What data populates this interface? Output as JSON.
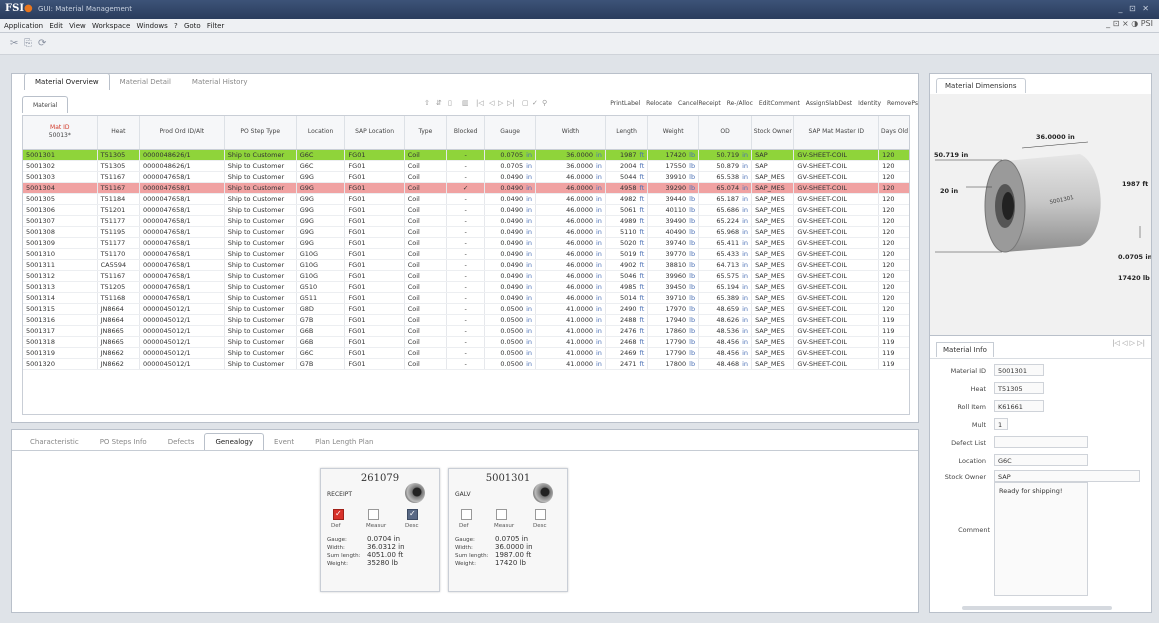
{
  "app": {
    "logo_text": "FSI",
    "window_title": "GUI: Material Management",
    "window_controls": "_ ⊡ ✕",
    "right_controls": "_ ⊡ × ◑ PSI"
  },
  "menu": [
    "Application",
    "Edit",
    "View",
    "Workspace",
    "Windows",
    "?",
    "Goto",
    "Filter"
  ],
  "main_tabs": [
    "Material Overview",
    "Material Detail",
    "Material History"
  ],
  "grid": {
    "label": "Material",
    "actions": [
      "PrintLabel",
      "Relocate",
      "CancelReceipt",
      "Re-/Alloc",
      "EditComment",
      "AssignSlabDest",
      "Identity",
      "RemovePs"
    ],
    "columns": [
      "Mat ID",
      "Heat",
      "Prod Ord ID/Alt",
      "PO Step Type",
      "Location",
      "SAP Location",
      "Type",
      "Blocked",
      "Gauge",
      "Width",
      "Length",
      "Weight",
      "OD",
      "Stock Owner",
      "SAP Mat Master ID",
      "Days Old"
    ],
    "filter_value": "50013*",
    "rows": [
      {
        "id": "5001301",
        "heat": "T51305",
        "po": "0000048626/1",
        "step": "Ship to Customer",
        "loc": "G6C",
        "sap": "FG01",
        "type": "Coil",
        "blocked": "-",
        "gauge": "0.0705",
        "width": "36.0000",
        "length": "1987",
        "weight": "17420",
        "od": "50.719",
        "owner": "SAP",
        "mm": "GV-SHEET-COIL",
        "days": "120",
        "hl": "green"
      },
      {
        "id": "5001302",
        "heat": "T51305",
        "po": "0000048626/1",
        "step": "Ship to Customer",
        "loc": "G6C",
        "sap": "FG01",
        "type": "Coil",
        "blocked": "-",
        "gauge": "0.0705",
        "width": "36.0000",
        "length": "2004",
        "weight": "17550",
        "od": "50.879",
        "owner": "SAP",
        "mm": "GV-SHEET-COIL",
        "days": "120",
        "hl": ""
      },
      {
        "id": "5001303",
        "heat": "T51167",
        "po": "0000047658/1",
        "step": "Ship to Customer",
        "loc": "G9G",
        "sap": "FG01",
        "type": "Coil",
        "blocked": "-",
        "gauge": "0.0490",
        "width": "46.0000",
        "length": "5044",
        "weight": "39910",
        "od": "65.538",
        "owner": "SAP_MES",
        "mm": "GV-SHEET-COIL",
        "days": "120",
        "hl": ""
      },
      {
        "id": "5001304",
        "heat": "T51167",
        "po": "0000047658/1",
        "step": "Ship to Customer",
        "loc": "G9G",
        "sap": "FG01",
        "type": "Coil",
        "blocked": "✓",
        "gauge": "0.0490",
        "width": "46.0000",
        "length": "4958",
        "weight": "39290",
        "od": "65.074",
        "owner": "SAP_MES",
        "mm": "GV-SHEET-COIL",
        "days": "120",
        "hl": "red"
      },
      {
        "id": "5001305",
        "heat": "T51184",
        "po": "0000047658/1",
        "step": "Ship to Customer",
        "loc": "G9G",
        "sap": "FG01",
        "type": "Coil",
        "blocked": "-",
        "gauge": "0.0490",
        "width": "46.0000",
        "length": "4982",
        "weight": "39440",
        "od": "65.187",
        "owner": "SAP_MES",
        "mm": "GV-SHEET-COIL",
        "days": "120",
        "hl": ""
      },
      {
        "id": "5001306",
        "heat": "T51201",
        "po": "0000047658/1",
        "step": "Ship to Customer",
        "loc": "G9G",
        "sap": "FG01",
        "type": "Coil",
        "blocked": "-",
        "gauge": "0.0490",
        "width": "46.0000",
        "length": "5061",
        "weight": "40110",
        "od": "65.686",
        "owner": "SAP_MES",
        "mm": "GV-SHEET-COIL",
        "days": "120",
        "hl": ""
      },
      {
        "id": "5001307",
        "heat": "T51177",
        "po": "0000047658/1",
        "step": "Ship to Customer",
        "loc": "G9G",
        "sap": "FG01",
        "type": "Coil",
        "blocked": "-",
        "gauge": "0.0490",
        "width": "46.0000",
        "length": "4989",
        "weight": "39490",
        "od": "65.224",
        "owner": "SAP_MES",
        "mm": "GV-SHEET-COIL",
        "days": "120",
        "hl": ""
      },
      {
        "id": "5001308",
        "heat": "T51195",
        "po": "0000047658/1",
        "step": "Ship to Customer",
        "loc": "G9G",
        "sap": "FG01",
        "type": "Coil",
        "blocked": "-",
        "gauge": "0.0490",
        "width": "46.0000",
        "length": "5110",
        "weight": "40490",
        "od": "65.968",
        "owner": "SAP_MES",
        "mm": "GV-SHEET-COIL",
        "days": "120",
        "hl": ""
      },
      {
        "id": "5001309",
        "heat": "T51177",
        "po": "0000047658/1",
        "step": "Ship to Customer",
        "loc": "G9G",
        "sap": "FG01",
        "type": "Coil",
        "blocked": "-",
        "gauge": "0.0490",
        "width": "46.0000",
        "length": "5020",
        "weight": "39740",
        "od": "65.411",
        "owner": "SAP_MES",
        "mm": "GV-SHEET-COIL",
        "days": "120",
        "hl": ""
      },
      {
        "id": "5001310",
        "heat": "T51170",
        "po": "0000047658/1",
        "step": "Ship to Customer",
        "loc": "G10G",
        "sap": "FG01",
        "type": "Coil",
        "blocked": "-",
        "gauge": "0.0490",
        "width": "46.0000",
        "length": "5019",
        "weight": "39770",
        "od": "65.433",
        "owner": "SAP_MES",
        "mm": "GV-SHEET-COIL",
        "days": "120",
        "hl": ""
      },
      {
        "id": "5001311",
        "heat": "CA5594",
        "po": "0000047658/1",
        "step": "Ship to Customer",
        "loc": "G10G",
        "sap": "FG01",
        "type": "Coil",
        "blocked": "-",
        "gauge": "0.0490",
        "width": "46.0000",
        "length": "4902",
        "weight": "38810",
        "od": "64.713",
        "owner": "SAP_MES",
        "mm": "GV-SHEET-COIL",
        "days": "120",
        "hl": ""
      },
      {
        "id": "5001312",
        "heat": "T51167",
        "po": "0000047658/1",
        "step": "Ship to Customer",
        "loc": "G10G",
        "sap": "FG01",
        "type": "Coil",
        "blocked": "-",
        "gauge": "0.0490",
        "width": "46.0000",
        "length": "5046",
        "weight": "39960",
        "od": "65.575",
        "owner": "SAP_MES",
        "mm": "GV-SHEET-COIL",
        "days": "120",
        "hl": ""
      },
      {
        "id": "5001313",
        "heat": "T51205",
        "po": "0000047658/1",
        "step": "Ship to Customer",
        "loc": "G510",
        "sap": "FG01",
        "type": "Coil",
        "blocked": "-",
        "gauge": "0.0490",
        "width": "46.0000",
        "length": "4985",
        "weight": "39450",
        "od": "65.194",
        "owner": "SAP_MES",
        "mm": "GV-SHEET-COIL",
        "days": "120",
        "hl": ""
      },
      {
        "id": "5001314",
        "heat": "T51168",
        "po": "0000047658/1",
        "step": "Ship to Customer",
        "loc": "G511",
        "sap": "FG01",
        "type": "Coil",
        "blocked": "-",
        "gauge": "0.0490",
        "width": "46.0000",
        "length": "5014",
        "weight": "39710",
        "od": "65.389",
        "owner": "SAP_MES",
        "mm": "GV-SHEET-COIL",
        "days": "120",
        "hl": ""
      },
      {
        "id": "5001315",
        "heat": "JN8664",
        "po": "0000045012/1",
        "step": "Ship to Customer",
        "loc": "G8D",
        "sap": "FG01",
        "type": "Coil",
        "blocked": "-",
        "gauge": "0.0500",
        "width": "41.0000",
        "length": "2490",
        "weight": "17970",
        "od": "48.659",
        "owner": "SAP_MES",
        "mm": "GV-SHEET-COIL",
        "days": "120",
        "hl": ""
      },
      {
        "id": "5001316",
        "heat": "JN8664",
        "po": "0000045012/1",
        "step": "Ship to Customer",
        "loc": "G7B",
        "sap": "FG01",
        "type": "Coil",
        "blocked": "-",
        "gauge": "0.0500",
        "width": "41.0000",
        "length": "2488",
        "weight": "17940",
        "od": "48.626",
        "owner": "SAP_MES",
        "mm": "GV-SHEET-COIL",
        "days": "119",
        "hl": ""
      },
      {
        "id": "5001317",
        "heat": "JN8665",
        "po": "0000045012/1",
        "step": "Ship to Customer",
        "loc": "G6B",
        "sap": "FG01",
        "type": "Coil",
        "blocked": "-",
        "gauge": "0.0500",
        "width": "41.0000",
        "length": "2476",
        "weight": "17860",
        "od": "48.536",
        "owner": "SAP_MES",
        "mm": "GV-SHEET-COIL",
        "days": "119",
        "hl": ""
      },
      {
        "id": "5001318",
        "heat": "JN8665",
        "po": "0000045012/1",
        "step": "Ship to Customer",
        "loc": "G6B",
        "sap": "FG01",
        "type": "Coil",
        "blocked": "-",
        "gauge": "0.0500",
        "width": "41.0000",
        "length": "2468",
        "weight": "17790",
        "od": "48.456",
        "owner": "SAP_MES",
        "mm": "GV-SHEET-COIL",
        "days": "119",
        "hl": ""
      },
      {
        "id": "5001319",
        "heat": "JN8662",
        "po": "0000045012/1",
        "step": "Ship to Customer",
        "loc": "G6C",
        "sap": "FG01",
        "type": "Coil",
        "blocked": "-",
        "gauge": "0.0500",
        "width": "41.0000",
        "length": "2469",
        "weight": "17790",
        "od": "48.456",
        "owner": "SAP_MES",
        "mm": "GV-SHEET-COIL",
        "days": "119",
        "hl": ""
      },
      {
        "id": "5001320",
        "heat": "JN8662",
        "po": "0000045012/1",
        "step": "Ship to Customer",
        "loc": "G7B",
        "sap": "FG01",
        "type": "Coil",
        "blocked": "-",
        "gauge": "0.0500",
        "width": "41.0000",
        "length": "2471",
        "weight": "17800",
        "od": "48.468",
        "owner": "SAP_MES",
        "mm": "GV-SHEET-COIL",
        "days": "119",
        "hl": ""
      }
    ],
    "units": {
      "gauge": "in",
      "width": "in",
      "length": "ft",
      "weight": "lb",
      "od": "in"
    }
  },
  "dimensions": {
    "tab": "Material Dimensions",
    "od": "50.719 in",
    "width": "36.0000 in",
    "length": "1987 ft",
    "id": "20 in",
    "gauge": "0.0705 in",
    "weight": "17420 lb",
    "coil_label": "5001301"
  },
  "info": {
    "tab": "Material Info",
    "fields": [
      {
        "label": "Material ID",
        "value": "5001301"
      },
      {
        "label": "Heat",
        "value": "T51305"
      },
      {
        "label": "Roll Item",
        "value": "K61661"
      },
      {
        "label": "Mult",
        "value": "1"
      },
      {
        "label": "Defect List",
        "value": ""
      },
      {
        "label": "Location",
        "value": "G6C"
      },
      {
        "label": "Stock Owner",
        "value": "SAP"
      }
    ],
    "comment_label": "Comment",
    "comment": "Ready for shipping!"
  },
  "bottom_tabs": [
    "Characteristic",
    "PO Steps Info",
    "Defects",
    "Genealogy",
    "Event",
    "Plan Length Plan"
  ],
  "genealogy": {
    "cards": [
      {
        "id": "261079",
        "type": "RECEIPT",
        "checks": [
          "Def",
          "Measur",
          "Desc"
        ],
        "gauge": "0.0704 in",
        "width": "36.0312 in",
        "length": "4051.00 ft",
        "weight": "35280 lb"
      },
      {
        "id": "5001301",
        "type": "GALV",
        "checks": [
          "Def",
          "Measur",
          "Desc"
        ],
        "gauge": "0.0705 in",
        "width": "36.0000 in",
        "length": "1987.00 ft",
        "weight": "17420 lb"
      }
    ],
    "keys": [
      "Gauge:",
      "Width:",
      "Sum length:",
      "Weight:"
    ]
  }
}
